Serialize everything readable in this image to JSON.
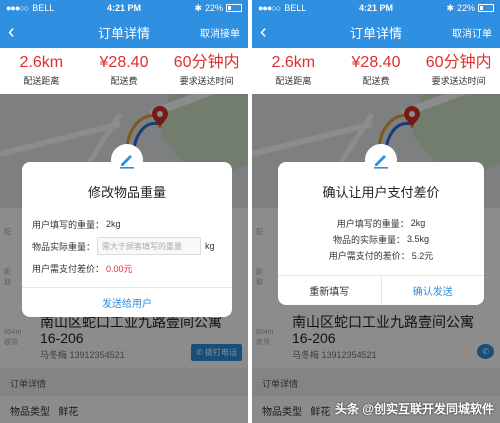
{
  "status": {
    "carrier": "BELL",
    "time": "4:21 PM",
    "battery": "22%"
  },
  "nav": {
    "title": "订单详情",
    "action_left": "取消接单",
    "action_right": "取消订单"
  },
  "stats": [
    {
      "value": "2.6km",
      "label": "配送距离"
    },
    {
      "value": "¥28.40",
      "label": "配送费"
    },
    {
      "value": "60分钟内",
      "label": "要求送达时间"
    }
  ],
  "address": {
    "line": "南山区蛇口工业九路壹间公寓16-206",
    "name": "马冬梅",
    "phone": "13912354521",
    "call_button": "拨打电话"
  },
  "order_detail": {
    "header": "订单详情",
    "item_type_label": "物品类型",
    "item_type_value": "鲜花"
  },
  "left_modal": {
    "title": "修改物品重量",
    "user_weight_label": "用户填写的重量：",
    "user_weight_value": "2kg",
    "actual_weight_label": "物品实际重量：",
    "actual_weight_placeholder": "需大于顾客填写的重量",
    "unit": "kg",
    "diff_label": "用户需支付差价：",
    "diff_value": "0.00元",
    "send_button": "发送给用户"
  },
  "right_modal": {
    "title": "确认让用户支付差价",
    "user_weight_label": "用户填写的重量：",
    "user_weight_value": "2kg",
    "actual_weight_label": "物品的实际重量：",
    "actual_weight_value": "3.5kg",
    "diff_label": "用户需支付的差价：",
    "diff_value": "5.2元",
    "refill_button": "重新填写",
    "confirm_button": "确认发送"
  },
  "watermark": "头条 @创实互联开发同城软件",
  "colors": {
    "brand_blue": "#2f8fe0",
    "accent_red": "#e02d2d"
  },
  "icons": [
    "back-arrow-icon",
    "pencil-icon",
    "map-pin-icon",
    "phone-icon"
  ]
}
